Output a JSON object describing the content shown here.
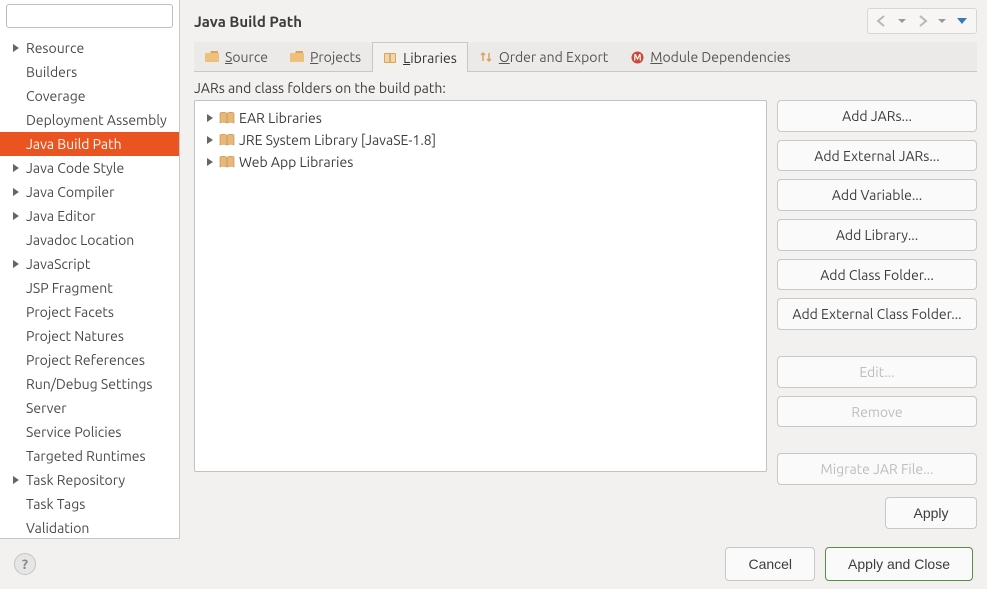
{
  "sidebar": {
    "search_placeholder": "",
    "items": [
      {
        "label": "Resource",
        "expandable": true
      },
      {
        "label": "Builders",
        "expandable": false
      },
      {
        "label": "Coverage",
        "expandable": false
      },
      {
        "label": "Deployment Assembly",
        "expandable": false
      },
      {
        "label": "Java Build Path",
        "expandable": false,
        "selected": true
      },
      {
        "label": "Java Code Style",
        "expandable": true
      },
      {
        "label": "Java Compiler",
        "expandable": true
      },
      {
        "label": "Java Editor",
        "expandable": true
      },
      {
        "label": "Javadoc Location",
        "expandable": false
      },
      {
        "label": "JavaScript",
        "expandable": true
      },
      {
        "label": "JSP Fragment",
        "expandable": false
      },
      {
        "label": "Project Facets",
        "expandable": false
      },
      {
        "label": "Project Natures",
        "expandable": false
      },
      {
        "label": "Project References",
        "expandable": false
      },
      {
        "label": "Run/Debug Settings",
        "expandable": false
      },
      {
        "label": "Server",
        "expandable": false
      },
      {
        "label": "Service Policies",
        "expandable": false
      },
      {
        "label": "Targeted Runtimes",
        "expandable": false
      },
      {
        "label": "Task Repository",
        "expandable": true
      },
      {
        "label": "Task Tags",
        "expandable": false
      },
      {
        "label": "Validation",
        "expandable": false
      }
    ]
  },
  "header": {
    "title": "Java Build Path"
  },
  "tabs": [
    {
      "mnemonic": "S",
      "rest": "ource",
      "icon": "folder"
    },
    {
      "mnemonic": "P",
      "rest": "rojects",
      "icon": "folder"
    },
    {
      "mnemonic": "L",
      "rest": "ibraries",
      "icon": "book",
      "active": true
    },
    {
      "mnemonic": "O",
      "rest": "rder and Export",
      "icon": "sort"
    },
    {
      "mnemonic": "M",
      "rest": "odule Dependencies",
      "icon": "module"
    }
  ],
  "panel": {
    "label": "JARs and class folders on the build path:",
    "items": [
      {
        "label": "EAR Libraries"
      },
      {
        "label": "JRE System Library [JavaSE-1.8]"
      },
      {
        "label": "Web App Libraries"
      }
    ]
  },
  "buttons": {
    "addJars": "Add JARs...",
    "addExtJars": "Add External JARs...",
    "addVar": "Add Variable...",
    "addLib": "Add Library...",
    "addClass": "Add Class Folder...",
    "addExtClass": "Add External Class Folder...",
    "edit": "Edit...",
    "remove": "Remove",
    "migrate": "Migrate JAR File...",
    "apply": "Apply"
  },
  "bottom": {
    "cancel": "Cancel",
    "applyClose": "Apply and Close"
  }
}
